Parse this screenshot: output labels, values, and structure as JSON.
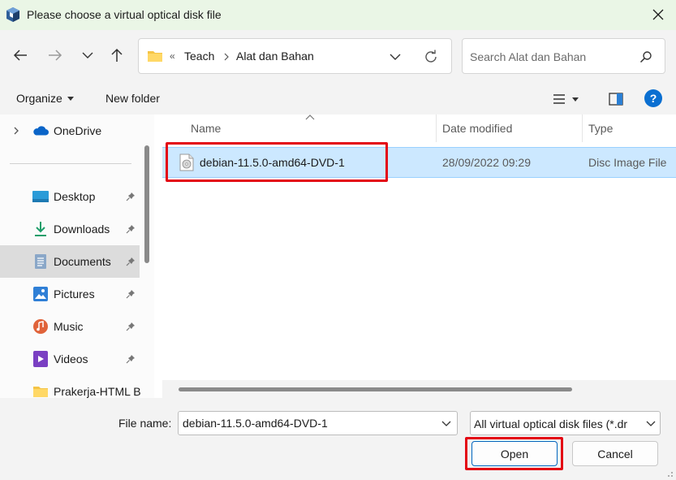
{
  "window": {
    "title": "Please choose a virtual optical disk file"
  },
  "nav": {
    "breadcrumb_overflow": "«",
    "breadcrumbs": [
      "Teach",
      "Alat dan Bahan"
    ],
    "search_placeholder": "Search Alat dan Bahan"
  },
  "toolbar": {
    "organize_label": "Organize",
    "new_folder_label": "New folder",
    "help_label": "?"
  },
  "sidebar": {
    "top_item": "OneDrive",
    "items": [
      {
        "label": "Desktop",
        "icon": "desktop-icon",
        "pinned": true
      },
      {
        "label": "Downloads",
        "icon": "downloads-icon",
        "pinned": true
      },
      {
        "label": "Documents",
        "icon": "documents-icon",
        "pinned": true,
        "selected": true
      },
      {
        "label": "Pictures",
        "icon": "pictures-icon",
        "pinned": true
      },
      {
        "label": "Music",
        "icon": "music-icon",
        "pinned": true
      },
      {
        "label": "Videos",
        "icon": "videos-icon",
        "pinned": true
      },
      {
        "label": "Prakerja-HTML B",
        "icon": "folder-icon",
        "pinned": false
      }
    ]
  },
  "columns": {
    "name": "Name",
    "date": "Date modified",
    "type": "Type"
  },
  "files": [
    {
      "name": "debian-11.5.0-amd64-DVD-1",
      "date": "28/09/2022 09:29",
      "type": "Disc Image File",
      "selected": true
    }
  ],
  "bottom": {
    "file_name_label": "File name:",
    "file_name_value": "debian-11.5.0-amd64-DVD-1",
    "filter_value": "All virtual optical disk files (*.dr",
    "open_label": "Open",
    "cancel_label": "Cancel"
  },
  "colors": {
    "titlebar_bg": "#eaf6e6",
    "selection_bg": "#cce8ff",
    "highlight_red": "#e30613",
    "accent_blue": "#0067c0"
  }
}
